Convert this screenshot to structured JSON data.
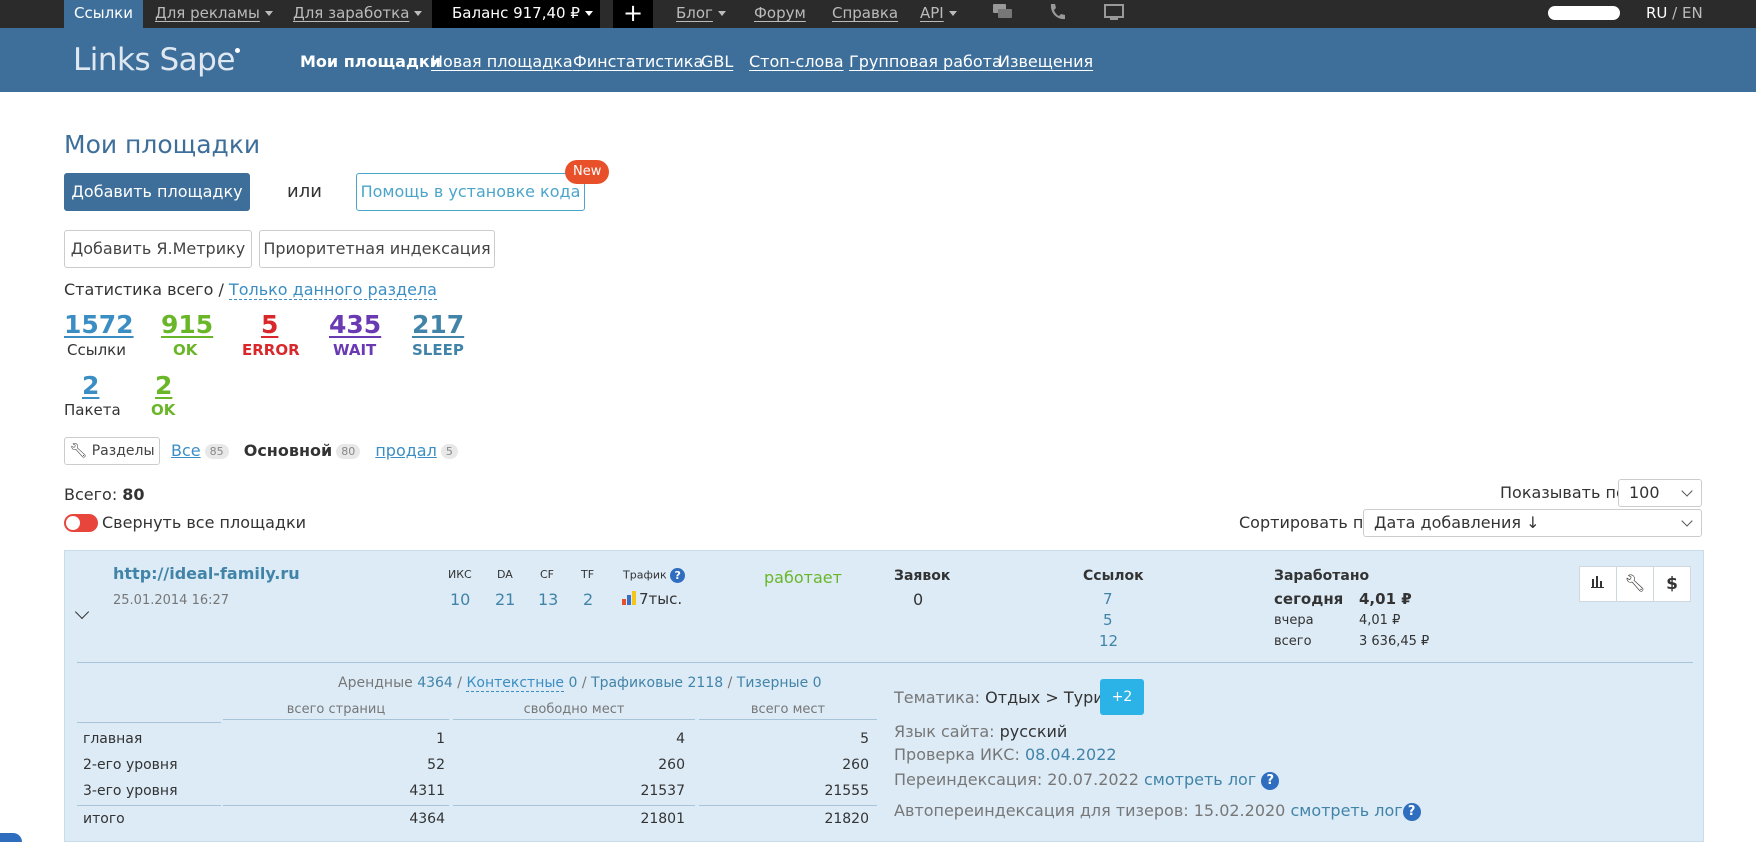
{
  "topbar": {
    "links": "Ссылки",
    "for_ads": "Для рекламы",
    "for_earn": "Для заработка",
    "balance": "Баланс 917,40 ₽",
    "plus": "+",
    "blog": "Блог",
    "forum": "Форум",
    "help": "Справка",
    "api": "API",
    "lang_ru": "RU",
    "lang_sep": " / ",
    "lang_en": "EN"
  },
  "header": {
    "logo_links": "Links",
    "logo_sape": "Sape",
    "nav": [
      "Мои площадки",
      "Новая площадка",
      "Финстатистика",
      "GBL",
      "Стоп-слова",
      "Групповая работа",
      "Извещения"
    ]
  },
  "page": {
    "title": "Мои площадки",
    "add_site": "Добавить площадку",
    "or": "или",
    "install_help": "Помощь в установке кода",
    "new_badge": "New",
    "add_metrika": "Добавить Я.Метрику",
    "priority_index": "Приоритетная индексация",
    "stats_all": "Статистика всего /",
    "stats_section": "Только данного раздела"
  },
  "stats": {
    "links": {
      "num": "1572",
      "label": "Ссылки"
    },
    "ok": {
      "num": "915",
      "label": "OK"
    },
    "error": {
      "num": "5",
      "label": "ERROR"
    },
    "wait": {
      "num": "435",
      "label": "WAIT"
    },
    "sleep": {
      "num": "217",
      "label": "SLEEP"
    },
    "packets": {
      "num": "2",
      "label": "Пакета"
    },
    "packets_ok": {
      "num": "2",
      "label": "OK"
    }
  },
  "sections": {
    "button": "Разделы",
    "all": "Все",
    "all_count": "85",
    "main": "Основной",
    "main_count": "80",
    "sold": "продал",
    "sold_count": "5"
  },
  "list": {
    "total_label": "Всего:",
    "total": "80",
    "collapse_all": "Свернуть все площадки",
    "show_by_label": "Показывать по:",
    "show_by": "100",
    "sort_label": "Сортировать по:",
    "sort": "Дата добавления ↓"
  },
  "site": {
    "url": "http://ideal-family.ru",
    "date": "25.01.2014 16:27",
    "iks_h": "ИКС",
    "da_h": "DA",
    "cf_h": "CF",
    "tf_h": "TF",
    "traffic_h": "Трафик",
    "iks": "10",
    "da": "21",
    "cf": "13",
    "tf": "2",
    "traffic": "7тыс.",
    "status": "работает",
    "requests_h": "Заявок",
    "requests": "0",
    "links_h": "Ссылок",
    "links": [
      "7",
      "5",
      "12"
    ],
    "earned_h": "Заработано",
    "today_l": "сегодня",
    "today": "4,01 ₽",
    "yesterday_l": "вчера",
    "yesterday": "4,01 ₽",
    "total_l": "всего",
    "total": "3 636,45 ₽",
    "types": {
      "rent_l": "Арендные",
      "rent": "4364",
      "ctx_l": "Контекстные",
      "ctx": "0",
      "traf_l": "Трафиковые",
      "traf": "2118",
      "teaser_l": "Тизерные",
      "teaser": "0"
    },
    "table": {
      "headers": [
        "всего страниц",
        "свободно мест",
        "всего мест"
      ],
      "rows": [
        {
          "label": "главная",
          "vals": [
            "1",
            "4",
            "5"
          ]
        },
        {
          "label": "2-его уровня",
          "vals": [
            "52",
            "260",
            "260"
          ]
        },
        {
          "label": "3-его уровня",
          "vals": [
            "4311",
            "21537",
            "21555"
          ]
        },
        {
          "label": "итого",
          "vals": [
            "4364",
            "21801",
            "21820"
          ]
        }
      ]
    },
    "theme_l": "Тематика:",
    "theme": "Отдых > Туризм",
    "theme_more": "+2",
    "lang_l": "Язык сайта:",
    "lang": "русский",
    "iks_check_l": "Проверка ИКС:",
    "iks_check": "08.04.2022",
    "reindex_l": "Переиндексация: 20.07.2022",
    "reindex_log": "смотреть лог",
    "auto_reindex_l": "Автопереиндексация для тизеров:",
    "auto_reindex": "15.02.2020",
    "auto_reindex_log": "смотреть лог",
    "help": "?"
  }
}
